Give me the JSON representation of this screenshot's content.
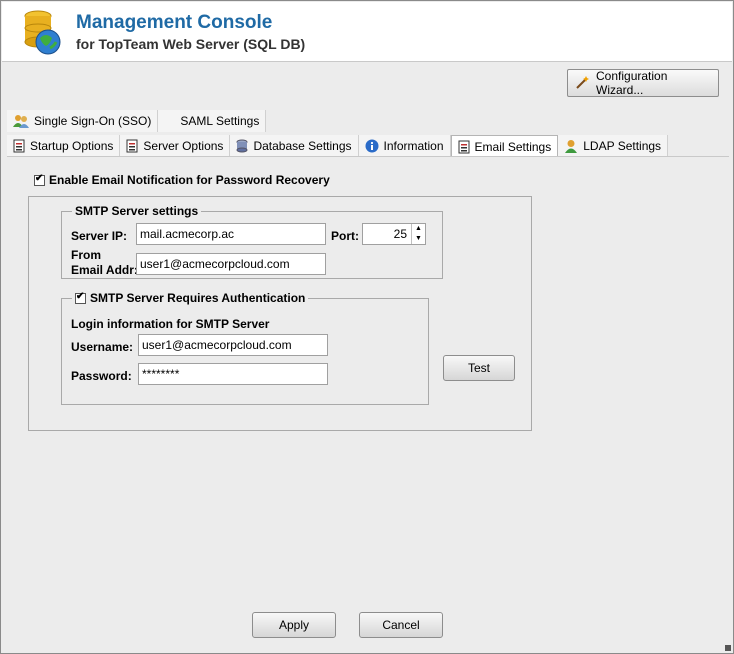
{
  "header": {
    "title": "Management Console",
    "subtitle": "for TopTeam Web Server (SQL DB)"
  },
  "toolbar": {
    "wizard_label": "Configuration Wizard..."
  },
  "tabs_row1": [
    {
      "label": "Single Sign-On (SSO)",
      "icon": "users-icon"
    },
    {
      "label": "SAML Settings",
      "icon": ""
    }
  ],
  "tabs_row2": [
    {
      "label": "Startup Options",
      "icon": "document-icon"
    },
    {
      "label": "Server Options",
      "icon": "document-icon"
    },
    {
      "label": "Database Settings",
      "icon": "database-icon"
    },
    {
      "label": "Information",
      "icon": "info-icon"
    },
    {
      "label": "Email Settings",
      "icon": "document-icon",
      "active": true
    },
    {
      "label": "LDAP Settings",
      "icon": "user-icon"
    }
  ],
  "email": {
    "enable_label": "Enable Email Notification for Password Recovery",
    "enable_checked": true,
    "smtp": {
      "title": "SMTP Server settings",
      "server_ip_label": "Server IP:",
      "server_ip_value": "mail.acmecorp.ac",
      "port_label": "Port:",
      "port_value": "25",
      "from_label_1": "From",
      "from_label_2": "Email Addr:",
      "from_value": "user1@acmecorpcloud.com"
    },
    "auth": {
      "title": "SMTP Server Requires Authentication",
      "checked": true,
      "login_info": "Login information for SMTP Server",
      "username_label": "Username:",
      "username_value": "user1@acmecorpcloud.com",
      "password_label": "Password:",
      "password_value": "********"
    },
    "test_label": "Test"
  },
  "footer": {
    "apply_label": "Apply",
    "cancel_label": "Cancel"
  }
}
